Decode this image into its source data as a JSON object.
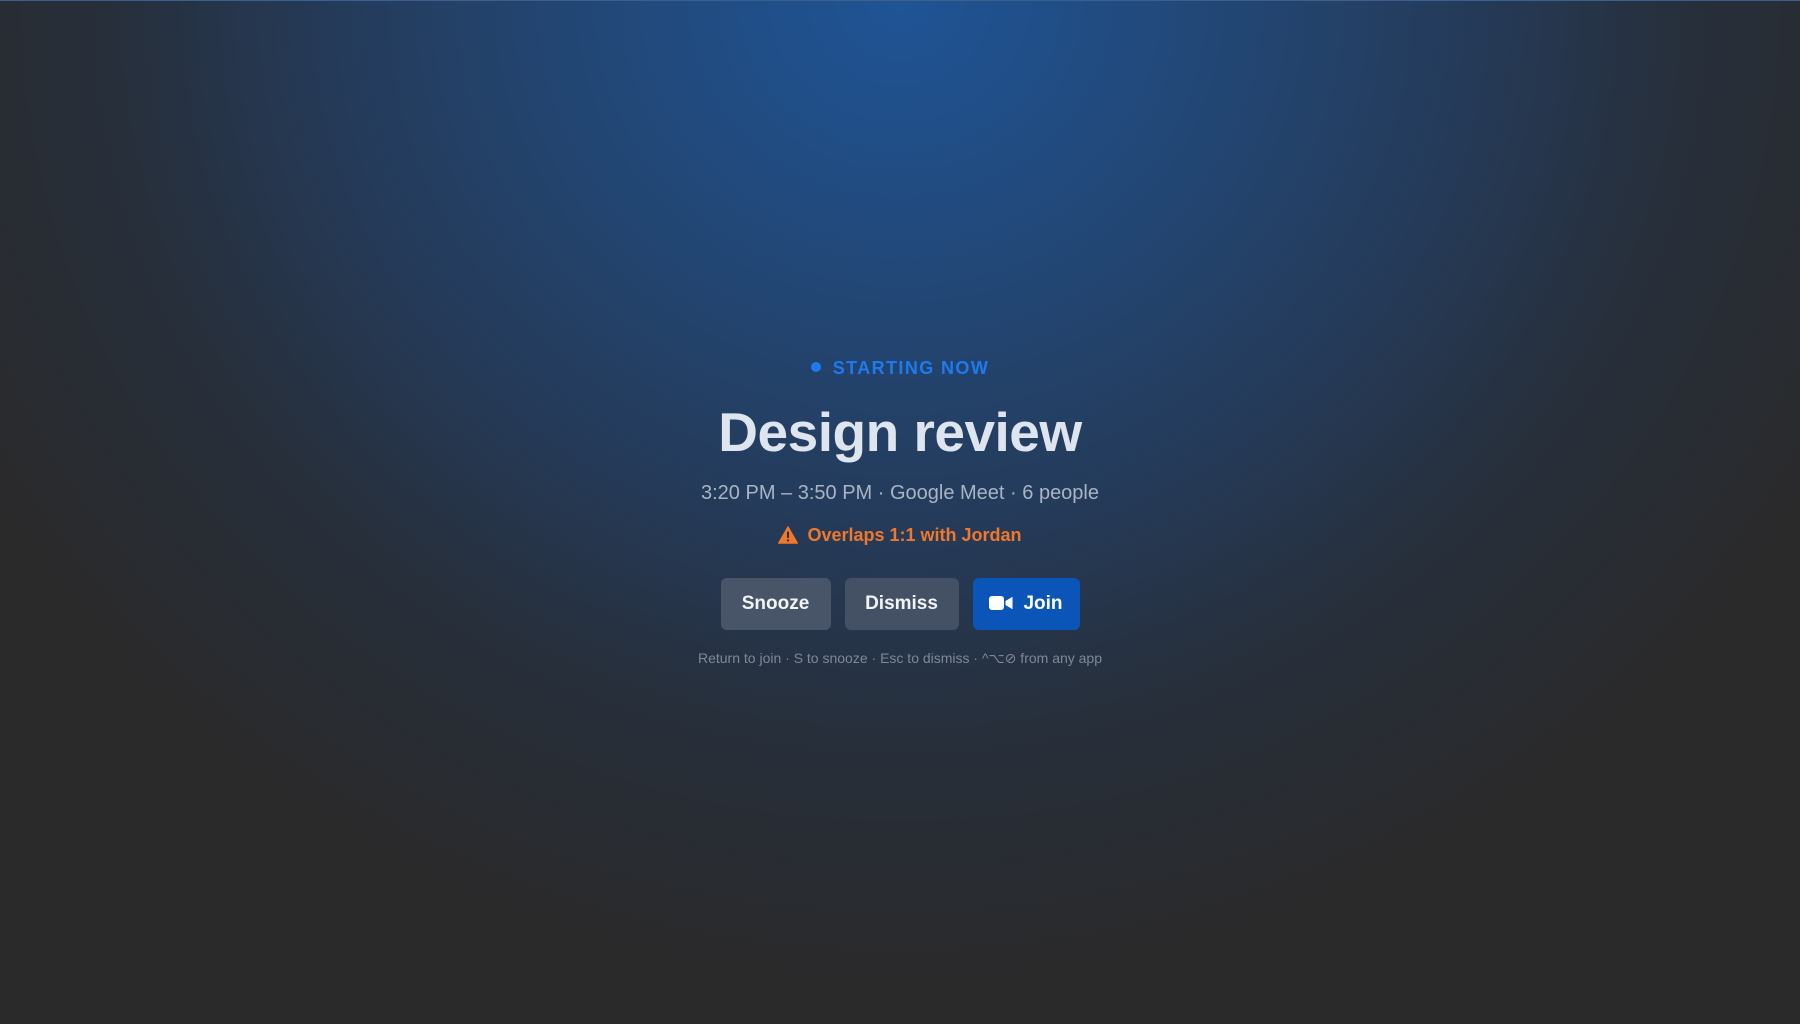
{
  "alert": {
    "status_label": "STARTING NOW",
    "title": "Design review",
    "meta": "3:20 PM – 3:50 PM · Google Meet · 6 people",
    "conflict": "Overlaps 1:1 with Jordan",
    "buttons": {
      "snooze": "Snooze",
      "dismiss": "Dismiss",
      "join": "Join"
    },
    "hints": "Return to join · S to snooze · Esc to dismiss · ^⌥⊘ from any app"
  },
  "icons": {
    "status": "dot-icon",
    "conflict": "warning-triangle-icon",
    "join": "video-camera-icon"
  },
  "colors": {
    "accent": "#1d7bf0",
    "warning": "#f0782a",
    "join_button": "#0b55b9",
    "secondary_button": "#485467"
  }
}
